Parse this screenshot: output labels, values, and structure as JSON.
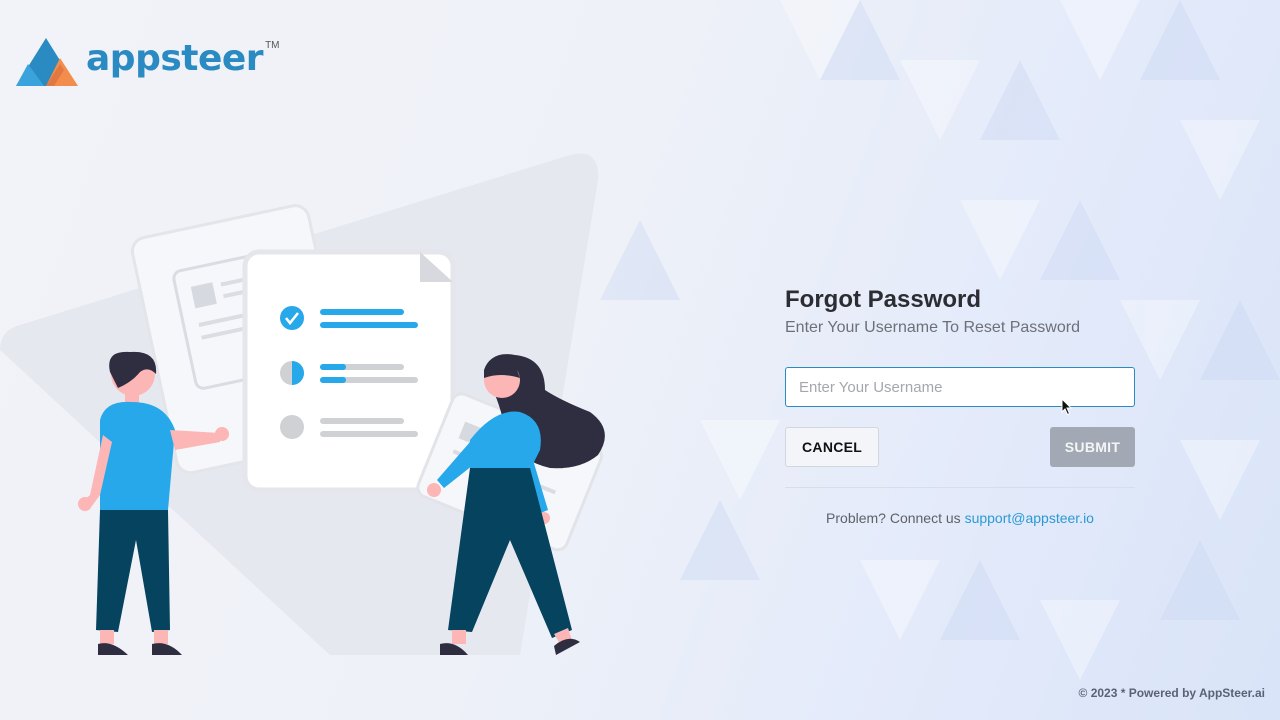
{
  "brand": {
    "name": "appsteer",
    "trademark": "TM",
    "colors": {
      "primary": "#2a8ac2",
      "accent_orange": "#f28d4c",
      "accent_blue": "#3a9fd8"
    }
  },
  "form": {
    "title": "Forgot Password",
    "subtitle": "Enter Your Username To Reset Password",
    "username_placeholder": "Enter Your Username",
    "username_value": "",
    "cancel_label": "CANCEL",
    "submit_label": "SUBMIT",
    "help_text": "Problem? Connect us",
    "support_email": "support@appsteer.io"
  },
  "footer": {
    "text": "© 2023 * Powered by AppSteer.ai"
  },
  "icons": [
    "logo-mark-icon",
    "check-icon",
    "mouse-cursor-icon"
  ]
}
